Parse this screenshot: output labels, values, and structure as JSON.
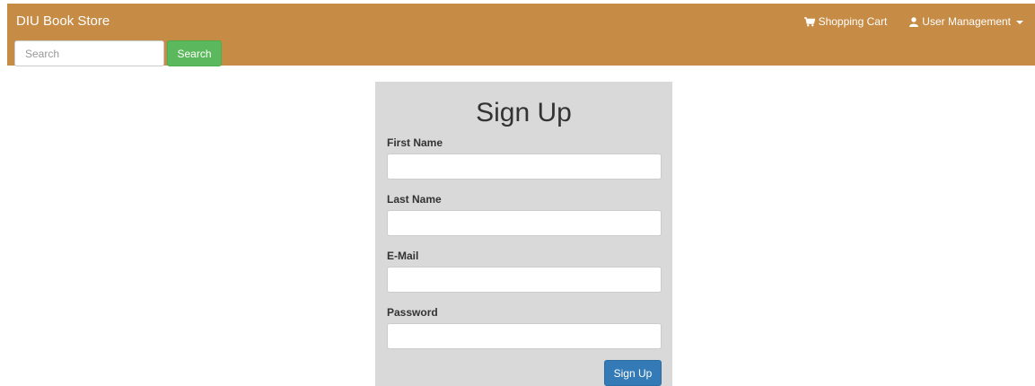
{
  "navbar": {
    "brand": "DIU Book Store",
    "search_placeholder": "Search",
    "search_button": "Search",
    "shopping_cart": "Shopping Cart",
    "user_management": "User Management",
    "cart_icon": "shopping-cart-icon",
    "user_icon": "user-icon",
    "background_color": "#c68b44"
  },
  "form": {
    "title": "Sign Up",
    "fields": [
      {
        "label": "First Name",
        "value": ""
      },
      {
        "label": "Last Name",
        "value": ""
      },
      {
        "label": "E-Mail",
        "value": ""
      },
      {
        "label": "Password",
        "value": ""
      }
    ],
    "submit_label": "Sign Up",
    "panel_color": "#d9d9d9",
    "submit_color": "#337ab7"
  }
}
